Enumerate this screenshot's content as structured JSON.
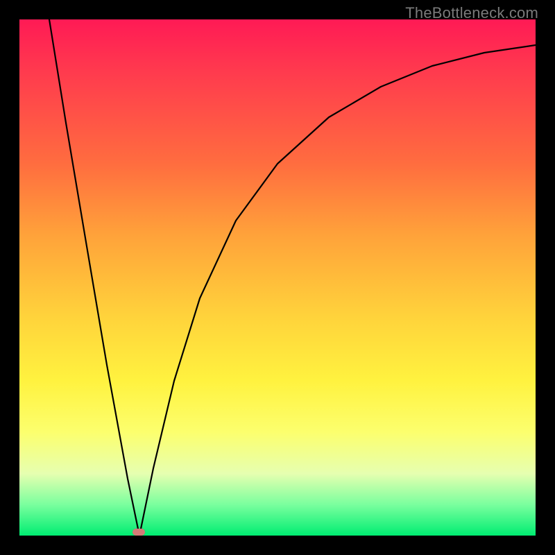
{
  "watermark": "TheBottleneck.com",
  "colors": {
    "frame": "#000000",
    "curve": "#000000",
    "marker": "#d47b78",
    "gradient_top": "#ff1a55",
    "gradient_bottom": "#00ed72"
  },
  "chart_data": {
    "type": "line",
    "title": "",
    "xlabel": "",
    "ylabel": "",
    "xlim": [
      0,
      1
    ],
    "ylim": [
      0,
      1
    ],
    "grid": false,
    "legend": false,
    "annotations": [
      {
        "text": "TheBottleneck.com",
        "position": "top-right"
      }
    ],
    "marker": {
      "x": 0.232,
      "y": 0.0,
      "shape": "pill",
      "color": "#d47b78"
    },
    "gradient": {
      "direction": "vertical",
      "stops": [
        {
          "pos": 0.0,
          "color": "#ff1a55"
        },
        {
          "pos": 0.1,
          "color": "#ff3a4e"
        },
        {
          "pos": 0.28,
          "color": "#ff6d3f"
        },
        {
          "pos": 0.42,
          "color": "#ffa33a"
        },
        {
          "pos": 0.58,
          "color": "#ffd43b"
        },
        {
          "pos": 0.7,
          "color": "#fff23f"
        },
        {
          "pos": 0.8,
          "color": "#fcff6e"
        },
        {
          "pos": 0.88,
          "color": "#e6ffb0"
        },
        {
          "pos": 0.94,
          "color": "#7aff9e"
        },
        {
          "pos": 1.0,
          "color": "#00ed72"
        }
      ]
    },
    "series": [
      {
        "name": "left-branch",
        "x": [
          0.058,
          0.09,
          0.13,
          0.17,
          0.21,
          0.232
        ],
        "y": [
          1.0,
          0.8,
          0.56,
          0.33,
          0.11,
          0.0
        ]
      },
      {
        "name": "right-branch",
        "x": [
          0.232,
          0.26,
          0.3,
          0.35,
          0.42,
          0.5,
          0.6,
          0.7,
          0.8,
          0.9,
          1.0
        ],
        "y": [
          0.0,
          0.13,
          0.3,
          0.46,
          0.61,
          0.72,
          0.81,
          0.87,
          0.91,
          0.935,
          0.95
        ]
      }
    ],
    "notes": "y=1 corresponds to top (red) edge, y=0 to bottom (green) edge"
  }
}
